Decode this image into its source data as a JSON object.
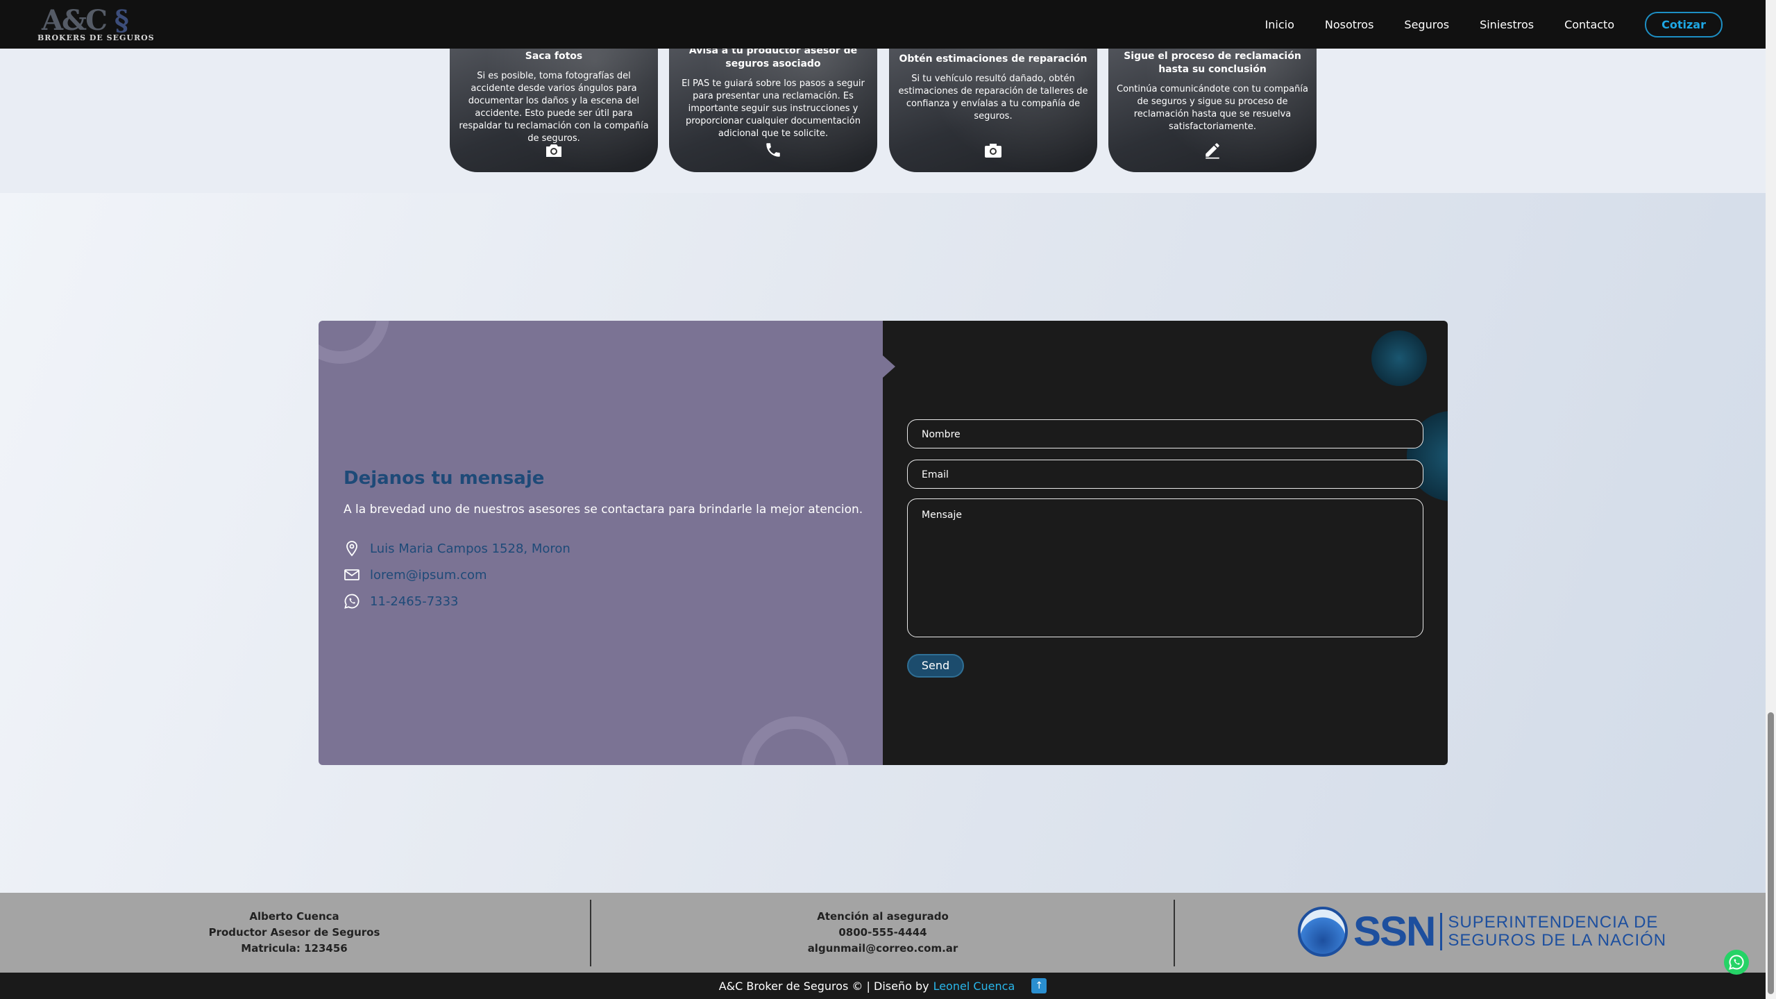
{
  "brand": {
    "logo_text": "A&C",
    "logo_tagline": "BROKERS DE SEGUROS"
  },
  "nav": {
    "items": [
      "Inicio",
      "Nosotros",
      "Seguros",
      "Siniestros",
      "Contacto"
    ],
    "cta": "Cotizar"
  },
  "steps": [
    {
      "title": "Saca fotos",
      "text": "Si es posible, toma fotografías del accidente desde varios ángulos para documentar los daños y la escena del accidente. Esto puede ser útil para respaldar tu reclamación con la compañía de seguros.",
      "icon": "camera-icon"
    },
    {
      "title": "Avisa a tu productor asesor de seguros asociado",
      "text": "El PAS te guiará sobre los pasos a seguir para presentar una reclamación. Es importante seguir sus instrucciones y proporcionar cualquier documentación adicional que te solicite.",
      "icon": "phone-icon"
    },
    {
      "title": "Obtén estimaciones de reparación",
      "text": "Si tu vehículo resultó dañado, obtén estimaciones de reparación de talleres de confianza y envíalas a tu compañía de seguros.",
      "icon": "photo-camera-icon"
    },
    {
      "title": "Sigue el proceso de reclamación hasta su conclusión",
      "text": "Continúa comunicándote con tu compañía de seguros y sigue su proceso de reclamación hasta que se resuelva satisfactoriamente.",
      "icon": "pencil-icon"
    }
  ],
  "contact": {
    "title": "Dejanos tu mensaje",
    "description": "A la brevedad uno de nuestros asesores se contactara para brindarle la mejor atencion.",
    "address": "Luis Maria Campos 1528, Moron",
    "email": "lorem@ipsum.com",
    "phone": "11-2465-7333",
    "form": {
      "name_placeholder": "Nombre",
      "email_placeholder": "Email",
      "message_placeholder": "Mensaje",
      "send_label": "Send"
    }
  },
  "footer": {
    "producer": {
      "name": "Alberto Cuenca",
      "role": "Productor Asesor de Seguros",
      "license": "Matricula: 123456"
    },
    "support": {
      "title": "Atención al asegurado",
      "phone": "0800-555-4444",
      "email": "algunmail@correo.com.ar"
    },
    "ssn": {
      "letters": "SSN",
      "line1": "SUPERINTENDENCIA DE",
      "line2": "SEGUROS DE LA NACIÓN"
    }
  },
  "bottom_bar": {
    "copyright": "A&C Broker de Seguros © | Diseño by",
    "designer": "Leonel Cuenca"
  },
  "colors": {
    "accent": "#1ea7e4",
    "contact_left": "#7b7394",
    "contact_title": "#1e4a78",
    "whatsapp": "#25d366"
  }
}
